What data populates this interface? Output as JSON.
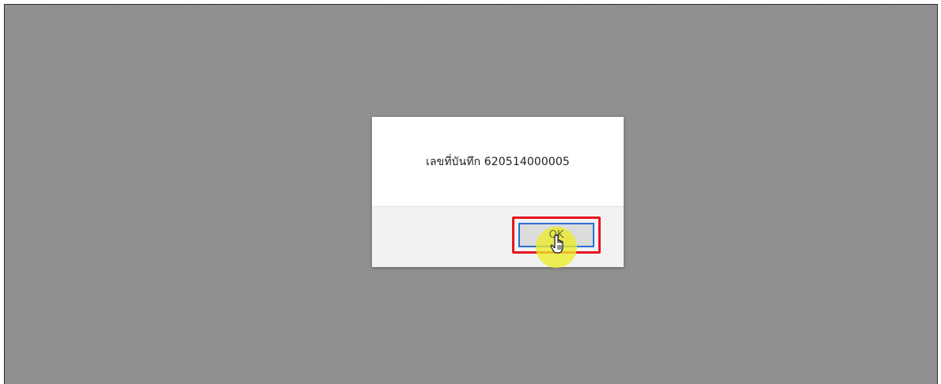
{
  "dialog": {
    "message": "เลขที่บันทึก 620514000005",
    "ok_label": "OK"
  },
  "colors": {
    "overlay": "#8f8f8f",
    "highlight_border": "#e5161f",
    "button_focus_border": "#2b6fd6",
    "click_indicator": "#ecec28"
  },
  "icons": {
    "cursor": "hand-pointer-icon"
  }
}
